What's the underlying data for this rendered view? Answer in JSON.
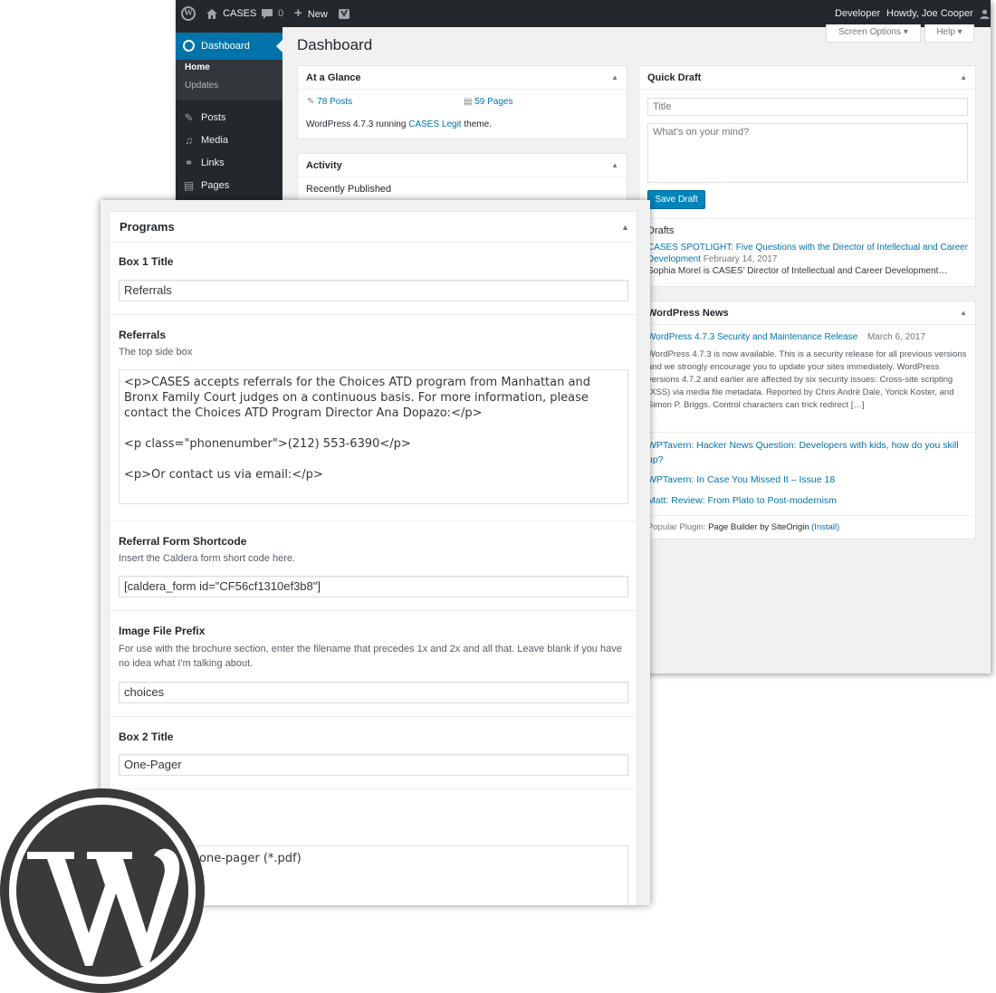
{
  "adminbar": {
    "site": "CASES",
    "comments_count": "0",
    "new_label": "New",
    "developer": "Developer",
    "howdy": "Howdy, Joe Cooper"
  },
  "sidebar": {
    "dashboard": "Dashboard",
    "home": "Home",
    "updates": "Updates",
    "items": [
      {
        "label": "Posts",
        "icon": "pin-icon"
      },
      {
        "label": "Media",
        "icon": "media-icon"
      },
      {
        "label": "Links",
        "icon": "link-icon"
      },
      {
        "label": "Pages",
        "icon": "page-icon"
      }
    ]
  },
  "header": {
    "title": "Dashboard",
    "screen_options": "Screen Options ▾",
    "help": "Help ▾"
  },
  "at_a_glance": {
    "title": "At a Glance",
    "posts": "78 Posts",
    "pages": "59 Pages",
    "running_pre": "WordPress 4.7.3 running ",
    "theme": "CASES Legit",
    "running_post": " theme."
  },
  "activity": {
    "title": "Activity",
    "recent": "Recently Published"
  },
  "quick_draft": {
    "title": "Quick Draft",
    "title_placeholder": "Title",
    "content_placeholder": "What’s on your mind?",
    "save": "Save Draft",
    "drafts_label": "Drafts",
    "draft_title": "CASES SPOTLIGHT: Five Questions with the Director of Intellectual and Career Development",
    "draft_date": "February 14, 2017",
    "draft_excerpt": "Sophia Morel is CASES’ Director of Intellectual and Career Development…"
  },
  "news": {
    "title": "WordPress News",
    "headline": "WordPress 4.7.3 Security and Maintenance Release",
    "date": "March 6, 2017",
    "body": "WordPress 4.7.3 is now available. This is a security release for all previous versions and we strongly encourage you to update your sites immediately. WordPress versions 4.7.2 and earlier are affected by six security issues: Cross-site scripting (XSS) via media file metadata.  Reported by Chris Andrè Dale, Yorick Koster, and Simon P. Briggs. Control characters can trick redirect […]",
    "links": [
      "WPTavern: Hacker News Question: Developers with kids, how do you skill up?",
      "WPTavern: In Case You Missed It – Issue 18",
      "Matt: Review: From Plato to Post-modernism"
    ],
    "popular_pre": "Popular Plugin: ",
    "popular_name": "Page Builder by SiteOrigin",
    "popular_install": "(Install)"
  },
  "programs": {
    "title": "Programs",
    "box1_label": "Box 1 Title",
    "box1_value": "Referrals",
    "referrals_label": "Referrals",
    "referrals_desc": "The top side box",
    "referrals_text": "<p>CASES accepts referrals for the Choices ATD program from Manhattan and Bronx Family Court judges on a continuous basis. For more information, please contact the Choices ATD Program Director Ana Dopazo:</p>\n\n<p class=\"phonenumber\">(212) 553-6390</p>\n\n<p>Or contact us via email:</p>",
    "shortcode_label": "Referral Form Shortcode",
    "shortcode_desc": "Insert the Caldera form short code here.",
    "shortcode_value": "[caldera_form id=\"CF56cf1310ef3b8\"]",
    "prefix_label": "Image File Prefix",
    "prefix_desc": "For use with the brochure section, enter the filename that precedes 1x and 2x and all that. Leave blank if you have no idea what I'm talking about.",
    "prefix_value": "choices",
    "box2_label": "Box 2 Title",
    "box2_value": "One-Pager",
    "box2_text": "one-pager (*.pdf)"
  },
  "logo": {
    "icon": "wordpress-logo",
    "color": "#3a3a3a"
  },
  "colors": {
    "accent": "#0073aa",
    "adminbar": "#23282d",
    "button": "#0085ba"
  }
}
